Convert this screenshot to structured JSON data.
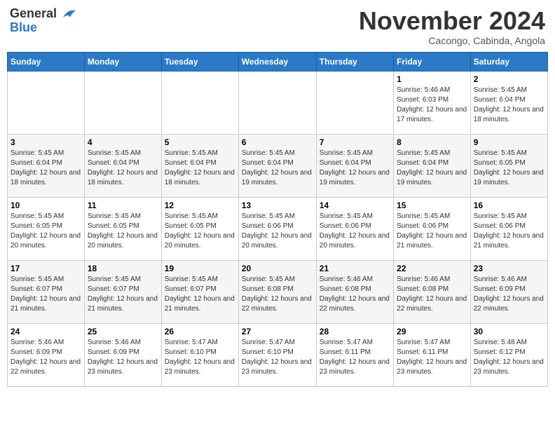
{
  "header": {
    "logo_line1": "General",
    "logo_line2": "Blue",
    "month": "November 2024",
    "location": "Cacongo, Cabinda, Angola"
  },
  "days_of_week": [
    "Sunday",
    "Monday",
    "Tuesday",
    "Wednesday",
    "Thursday",
    "Friday",
    "Saturday"
  ],
  "weeks": [
    [
      {
        "day": "",
        "info": ""
      },
      {
        "day": "",
        "info": ""
      },
      {
        "day": "",
        "info": ""
      },
      {
        "day": "",
        "info": ""
      },
      {
        "day": "",
        "info": ""
      },
      {
        "day": "1",
        "info": "Sunrise: 5:46 AM\nSunset: 6:03 PM\nDaylight: 12 hours and 17 minutes."
      },
      {
        "day": "2",
        "info": "Sunrise: 5:45 AM\nSunset: 6:04 PM\nDaylight: 12 hours and 18 minutes."
      }
    ],
    [
      {
        "day": "3",
        "info": "Sunrise: 5:45 AM\nSunset: 6:04 PM\nDaylight: 12 hours and 18 minutes."
      },
      {
        "day": "4",
        "info": "Sunrise: 5:45 AM\nSunset: 6:04 PM\nDaylight: 12 hours and 18 minutes."
      },
      {
        "day": "5",
        "info": "Sunrise: 5:45 AM\nSunset: 6:04 PM\nDaylight: 12 hours and 18 minutes."
      },
      {
        "day": "6",
        "info": "Sunrise: 5:45 AM\nSunset: 6:04 PM\nDaylight: 12 hours and 19 minutes."
      },
      {
        "day": "7",
        "info": "Sunrise: 5:45 AM\nSunset: 6:04 PM\nDaylight: 12 hours and 19 minutes."
      },
      {
        "day": "8",
        "info": "Sunrise: 5:45 AM\nSunset: 6:04 PM\nDaylight: 12 hours and 19 minutes."
      },
      {
        "day": "9",
        "info": "Sunrise: 5:45 AM\nSunset: 6:05 PM\nDaylight: 12 hours and 19 minutes."
      }
    ],
    [
      {
        "day": "10",
        "info": "Sunrise: 5:45 AM\nSunset: 6:05 PM\nDaylight: 12 hours and 20 minutes."
      },
      {
        "day": "11",
        "info": "Sunrise: 5:45 AM\nSunset: 6:05 PM\nDaylight: 12 hours and 20 minutes."
      },
      {
        "day": "12",
        "info": "Sunrise: 5:45 AM\nSunset: 6:05 PM\nDaylight: 12 hours and 20 minutes."
      },
      {
        "day": "13",
        "info": "Sunrise: 5:45 AM\nSunset: 6:06 PM\nDaylight: 12 hours and 20 minutes."
      },
      {
        "day": "14",
        "info": "Sunrise: 5:45 AM\nSunset: 6:06 PM\nDaylight: 12 hours and 20 minutes."
      },
      {
        "day": "15",
        "info": "Sunrise: 5:45 AM\nSunset: 6:06 PM\nDaylight: 12 hours and 21 minutes."
      },
      {
        "day": "16",
        "info": "Sunrise: 5:45 AM\nSunset: 6:06 PM\nDaylight: 12 hours and 21 minutes."
      }
    ],
    [
      {
        "day": "17",
        "info": "Sunrise: 5:45 AM\nSunset: 6:07 PM\nDaylight: 12 hours and 21 minutes."
      },
      {
        "day": "18",
        "info": "Sunrise: 5:45 AM\nSunset: 6:07 PM\nDaylight: 12 hours and 21 minutes."
      },
      {
        "day": "19",
        "info": "Sunrise: 5:45 AM\nSunset: 6:07 PM\nDaylight: 12 hours and 21 minutes."
      },
      {
        "day": "20",
        "info": "Sunrise: 5:45 AM\nSunset: 6:08 PM\nDaylight: 12 hours and 22 minutes."
      },
      {
        "day": "21",
        "info": "Sunrise: 5:46 AM\nSunset: 6:08 PM\nDaylight: 12 hours and 22 minutes."
      },
      {
        "day": "22",
        "info": "Sunrise: 5:46 AM\nSunset: 6:08 PM\nDaylight: 12 hours and 22 minutes."
      },
      {
        "day": "23",
        "info": "Sunrise: 5:46 AM\nSunset: 6:09 PM\nDaylight: 12 hours and 22 minutes."
      }
    ],
    [
      {
        "day": "24",
        "info": "Sunrise: 5:46 AM\nSunset: 6:09 PM\nDaylight: 12 hours and 22 minutes."
      },
      {
        "day": "25",
        "info": "Sunrise: 5:46 AM\nSunset: 6:09 PM\nDaylight: 12 hours and 23 minutes."
      },
      {
        "day": "26",
        "info": "Sunrise: 5:47 AM\nSunset: 6:10 PM\nDaylight: 12 hours and 23 minutes."
      },
      {
        "day": "27",
        "info": "Sunrise: 5:47 AM\nSunset: 6:10 PM\nDaylight: 12 hours and 23 minutes."
      },
      {
        "day": "28",
        "info": "Sunrise: 5:47 AM\nSunset: 6:11 PM\nDaylight: 12 hours and 23 minutes."
      },
      {
        "day": "29",
        "info": "Sunrise: 5:47 AM\nSunset: 6:11 PM\nDaylight: 12 hours and 23 minutes."
      },
      {
        "day": "30",
        "info": "Sunrise: 5:48 AM\nSunset: 6:12 PM\nDaylight: 12 hours and 23 minutes."
      }
    ]
  ]
}
